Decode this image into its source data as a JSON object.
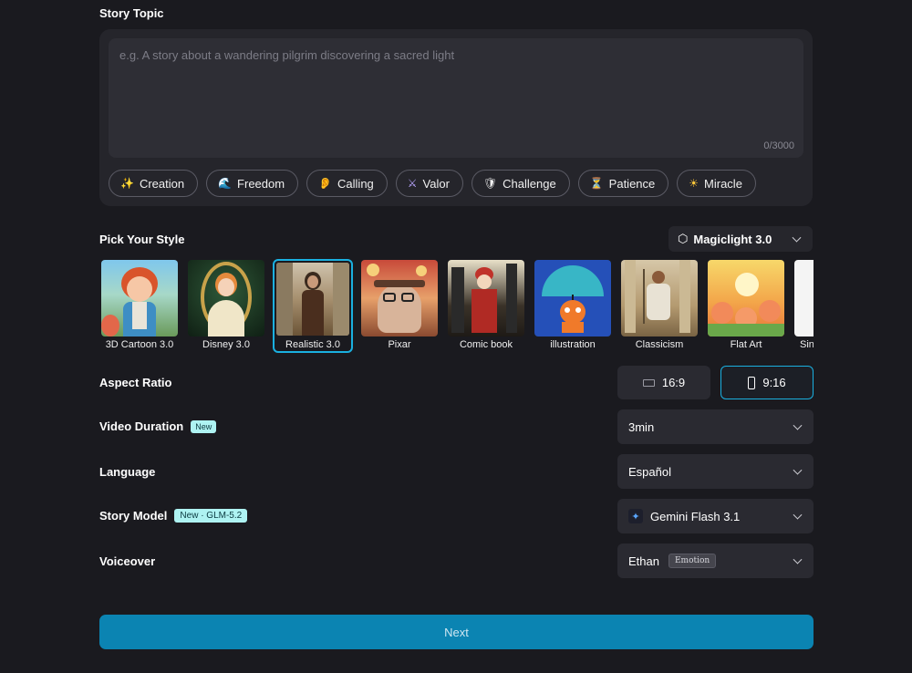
{
  "story_topic": {
    "label": "Story Topic",
    "placeholder": "e.g. A story about a wandering pilgrim discovering a sacred light",
    "char_count": "0/3000",
    "chips": [
      {
        "label": "Creation",
        "icon": "sparkles-icon",
        "glyph": "✨"
      },
      {
        "label": "Freedom",
        "icon": "wave-icon",
        "glyph": "🌊"
      },
      {
        "label": "Calling",
        "icon": "ear-icon",
        "glyph": "👂"
      },
      {
        "label": "Valor",
        "icon": "crossed-swords-icon",
        "glyph": "⚔"
      },
      {
        "label": "Challenge",
        "icon": "shield-icon",
        "glyph": "🛡"
      },
      {
        "label": "Patience",
        "icon": "hourglass-icon",
        "glyph": "⏳"
      },
      {
        "label": "Miracle",
        "icon": "sun-icon",
        "glyph": "☀"
      }
    ]
  },
  "style": {
    "label": "Pick Your Style",
    "model": "Magiclight 3.0",
    "selected": "Realistic 3.0",
    "items": [
      {
        "name": "3D Cartoon 3.0"
      },
      {
        "name": "Disney 3.0"
      },
      {
        "name": "Realistic 3.0"
      },
      {
        "name": "Pixar"
      },
      {
        "name": "Comic book"
      },
      {
        "name": "illustration"
      },
      {
        "name": "Classicism"
      },
      {
        "name": "Flat Art"
      },
      {
        "name": "Sin"
      }
    ]
  },
  "aspect_ratio": {
    "label": "Aspect Ratio",
    "options": [
      "16:9",
      "9:16"
    ],
    "selected": "9:16"
  },
  "video_duration": {
    "label": "Video Duration",
    "badge": "New",
    "value": "3min"
  },
  "language": {
    "label": "Language",
    "value": "Español"
  },
  "story_model": {
    "label": "Story Model",
    "badge": "New · GLM-5.2",
    "value": "Gemini Flash 3.1"
  },
  "voiceover": {
    "label": "Voiceover",
    "value": "Ethan",
    "tag": "Emotion"
  },
  "next_label": "Next",
  "colors": {
    "background": "#1a1a1f",
    "panel": "#25252b",
    "accent": "#1ab0e0",
    "primary_button": "#0b84b2",
    "badge": "#aef3f2"
  }
}
